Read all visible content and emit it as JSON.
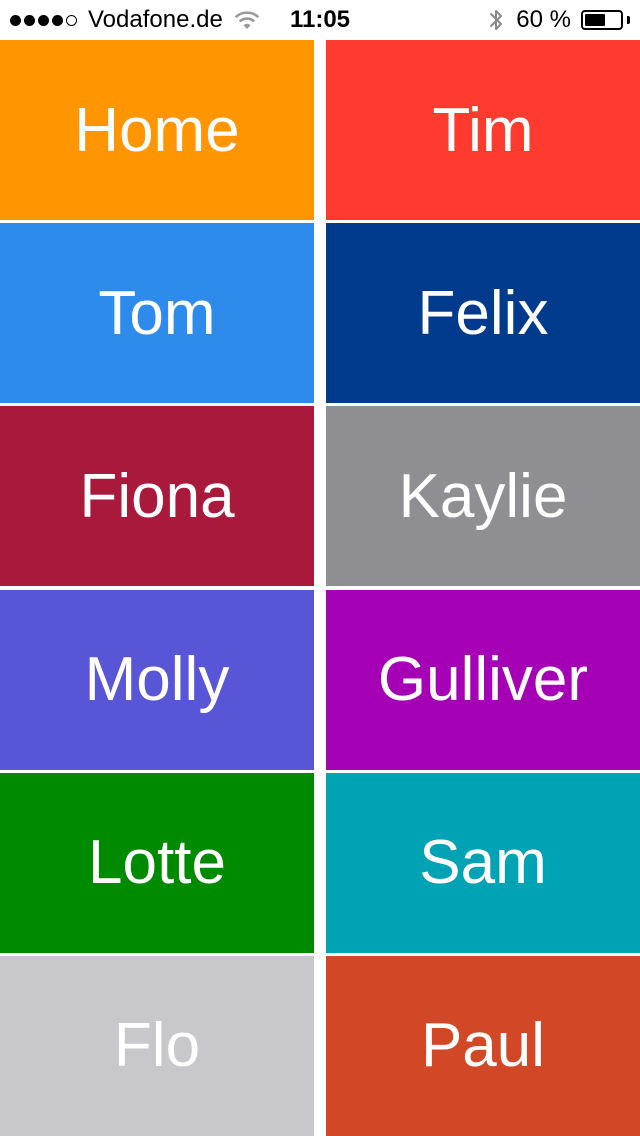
{
  "status_bar": {
    "signal_dots_filled": 4,
    "signal_dots_total": 5,
    "carrier": "Vodafone.de",
    "time": "11:05",
    "battery_percent_label": "60 %",
    "battery_level": 0.6,
    "icons": [
      "wifi-icon",
      "bluetooth-icon",
      "battery-icon"
    ]
  },
  "tiles": [
    {
      "label": "Home",
      "color": "#FF9500"
    },
    {
      "label": "Tim",
      "color": "#FF3B30"
    },
    {
      "label": "Tom",
      "color": "#2D8CEB"
    },
    {
      "label": "Felix",
      "color": "#003A8C"
    },
    {
      "label": "Fiona",
      "color": "#A8193C"
    },
    {
      "label": "Kaylie",
      "color": "#8E8E93"
    },
    {
      "label": "Molly",
      "color": "#5856D6"
    },
    {
      "label": "Gulliver",
      "color": "#A500B5"
    },
    {
      "label": "Lotte",
      "color": "#008A00"
    },
    {
      "label": "Sam",
      "color": "#00A3B4"
    },
    {
      "label": "Flo",
      "color": "#C7C7CC"
    },
    {
      "label": "Paul",
      "color": "#D24726"
    }
  ]
}
